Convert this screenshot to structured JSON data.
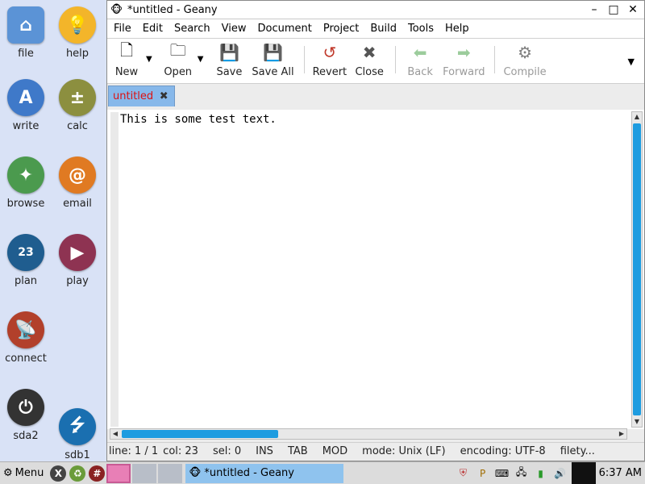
{
  "desktop": {
    "icons": [
      {
        "name": "file",
        "label": "file"
      },
      {
        "name": "help",
        "label": "help"
      },
      {
        "name": "write",
        "label": "write"
      },
      {
        "name": "calc",
        "label": "calc"
      },
      {
        "name": "browse",
        "label": "browse"
      },
      {
        "name": "email",
        "label": "email"
      },
      {
        "name": "plan",
        "label": "plan"
      },
      {
        "name": "play",
        "label": "play"
      },
      {
        "name": "connect",
        "label": "connect"
      },
      {
        "name": "sda2",
        "label": "sda2"
      },
      {
        "name": "sdb1",
        "label": "sdb1"
      }
    ],
    "plan_day": "23"
  },
  "window": {
    "title": "*untitled - Geany",
    "controls": {
      "minimize": "–",
      "maximize": "□",
      "close": "✕"
    }
  },
  "menu": [
    "File",
    "Edit",
    "Search",
    "View",
    "Document",
    "Project",
    "Build",
    "Tools",
    "Help"
  ],
  "toolbar": {
    "new": "New",
    "open": "Open",
    "save": "Save",
    "save_all": "Save All",
    "revert": "Revert",
    "close": "Close",
    "back": "Back",
    "forward": "Forward",
    "compile": "Compile"
  },
  "tab": {
    "label": "untitled"
  },
  "editor": {
    "text": "This is some test text."
  },
  "status": {
    "line": "line: 1 / 1",
    "col": "col: 23",
    "sel": "sel: 0",
    "ins": "INS",
    "tab": "TAB",
    "mod": "MOD",
    "mode": "mode: Unix (LF)",
    "encoding": "encoding: UTF-8",
    "filetype": "filety..."
  },
  "taskbar": {
    "menu_label": "Menu",
    "task_title": "*untitled - Geany",
    "clock": "6:37 AM"
  },
  "colors": {
    "accent_blue": "#1e9ce0",
    "tab_blue": "#87b8ea",
    "tab_label_red": "#d11111",
    "taskitem": "#8fc3ee"
  }
}
